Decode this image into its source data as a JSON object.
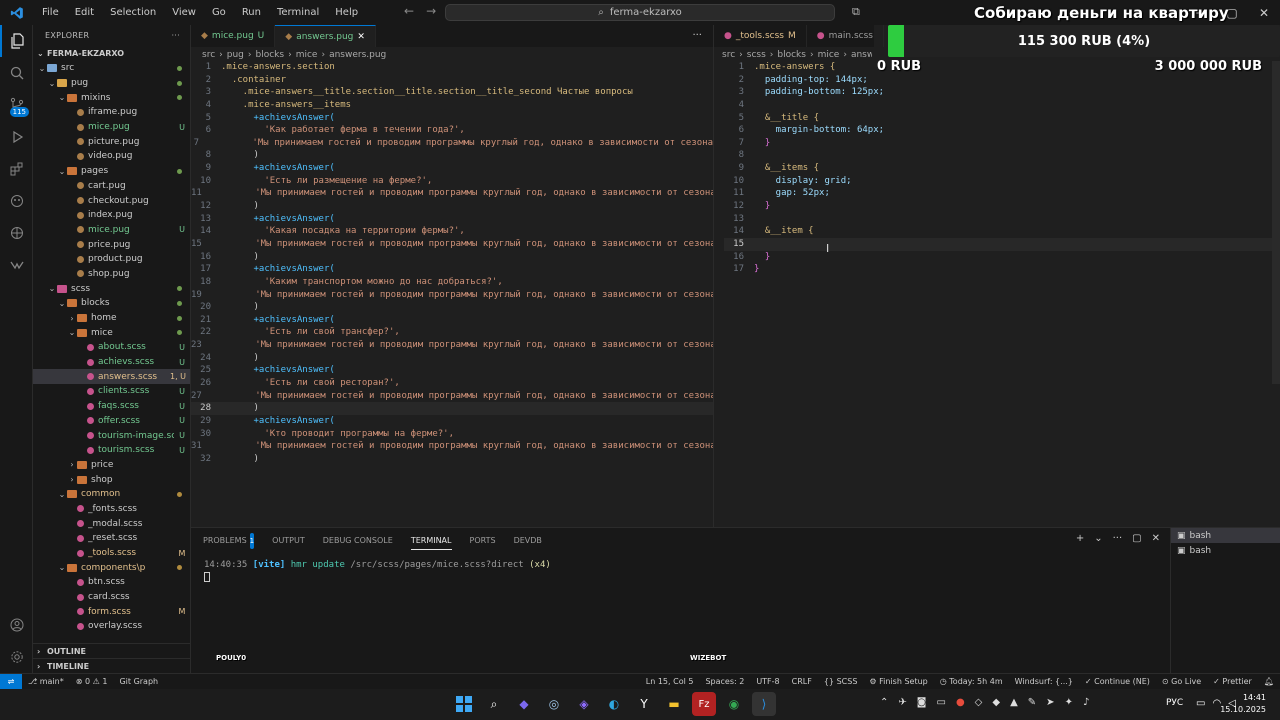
{
  "menu": [
    "File",
    "Edit",
    "Selection",
    "View",
    "Go",
    "Run",
    "Terminal",
    "Help"
  ],
  "command_center": "ferma-ekzarxo",
  "explorer": {
    "header": "EXPLORER",
    "project": "FERMA-EKZARXO",
    "rows": [
      {
        "label": "src",
        "depth": 1,
        "type": "folder",
        "open": true,
        "color": "#7ba7d4",
        "status": "",
        "dot": true
      },
      {
        "label": "pug",
        "depth": 2,
        "type": "folder",
        "open": true,
        "color": "#d9a54a",
        "status": "",
        "dot": true
      },
      {
        "label": "mixins",
        "depth": 3,
        "type": "folder",
        "open": true,
        "color": "#c9743a",
        "status": "",
        "dot": true
      },
      {
        "label": "iframe.pug",
        "depth": 4,
        "type": "file",
        "color": "#a87d4a",
        "status": ""
      },
      {
        "label": "mice.pug",
        "depth": 4,
        "type": "file",
        "color": "#a87d4a",
        "status": "U",
        "green": true
      },
      {
        "label": "picture.pug",
        "depth": 4,
        "type": "file",
        "color": "#a87d4a",
        "status": ""
      },
      {
        "label": "video.pug",
        "depth": 4,
        "type": "file",
        "color": "#a87d4a",
        "status": ""
      },
      {
        "label": "pages",
        "depth": 3,
        "type": "folder",
        "open": true,
        "color": "#c9743a",
        "status": "",
        "dot": true
      },
      {
        "label": "cart.pug",
        "depth": 4,
        "type": "file",
        "color": "#a87d4a",
        "status": ""
      },
      {
        "label": "checkout.pug",
        "depth": 4,
        "type": "file",
        "color": "#a87d4a",
        "status": ""
      },
      {
        "label": "index.pug",
        "depth": 4,
        "type": "file",
        "color": "#a87d4a",
        "status": ""
      },
      {
        "label": "mice.pug",
        "depth": 4,
        "type": "file",
        "color": "#a87d4a",
        "status": "U",
        "green": true
      },
      {
        "label": "price.pug",
        "depth": 4,
        "type": "file",
        "color": "#a87d4a",
        "status": ""
      },
      {
        "label": "product.pug",
        "depth": 4,
        "type": "file",
        "color": "#a87d4a",
        "status": ""
      },
      {
        "label": "shop.pug",
        "depth": 4,
        "type": "file",
        "color": "#a87d4a",
        "status": ""
      },
      {
        "label": "scss",
        "depth": 2,
        "type": "folder",
        "open": true,
        "color": "#c6538c",
        "status": "",
        "dot": true
      },
      {
        "label": "blocks",
        "depth": 3,
        "type": "folder",
        "open": true,
        "color": "#c9743a",
        "status": "",
        "dot": true
      },
      {
        "label": "home",
        "depth": 4,
        "type": "folder",
        "open": false,
        "color": "#c9743a",
        "status": "",
        "dot": true
      },
      {
        "label": "mice",
        "depth": 4,
        "type": "folder",
        "open": true,
        "color": "#c9743a",
        "status": "",
        "dot": true
      },
      {
        "label": "about.scss",
        "depth": 5,
        "type": "file",
        "color": "#c6538c",
        "status": "U",
        "green": true
      },
      {
        "label": "achievs.scss",
        "depth": 5,
        "type": "file",
        "color": "#c6538c",
        "status": "U",
        "green": true
      },
      {
        "label": "answers.scss",
        "depth": 5,
        "type": "file",
        "color": "#c6538c",
        "status": "1, U",
        "green": true,
        "selected": true
      },
      {
        "label": "clients.scss",
        "depth": 5,
        "type": "file",
        "color": "#c6538c",
        "status": "U",
        "green": true
      },
      {
        "label": "faqs.scss",
        "depth": 5,
        "type": "file",
        "color": "#c6538c",
        "status": "U",
        "green": true
      },
      {
        "label": "offer.scss",
        "depth": 5,
        "type": "file",
        "color": "#c6538c",
        "status": "U",
        "green": true
      },
      {
        "label": "tourism-image.scss",
        "depth": 5,
        "type": "file",
        "color": "#c6538c",
        "status": "U",
        "green": true
      },
      {
        "label": "tourism.scss",
        "depth": 5,
        "type": "file",
        "color": "#c6538c",
        "status": "U",
        "green": true
      },
      {
        "label": "price",
        "depth": 4,
        "type": "folder",
        "open": false,
        "color": "#c9743a",
        "status": ""
      },
      {
        "label": "shop",
        "depth": 4,
        "type": "folder",
        "open": false,
        "color": "#c9743a",
        "status": ""
      },
      {
        "label": "common",
        "depth": 3,
        "type": "folder",
        "open": true,
        "color": "#c9743a",
        "status": "",
        "dot": true,
        "orange": true
      },
      {
        "label": "_fonts.scss",
        "depth": 4,
        "type": "file",
        "color": "#c6538c",
        "status": ""
      },
      {
        "label": "_modal.scss",
        "depth": 4,
        "type": "file",
        "color": "#c6538c",
        "status": ""
      },
      {
        "label": "_reset.scss",
        "depth": 4,
        "type": "file",
        "color": "#c6538c",
        "status": ""
      },
      {
        "label": "_tools.scss",
        "depth": 4,
        "type": "file",
        "color": "#c6538c",
        "status": "M",
        "orange": true
      },
      {
        "label": "components\\p",
        "depth": 3,
        "type": "folder",
        "open": true,
        "color": "#c9743a",
        "status": "",
        "dot": true,
        "orange": true
      },
      {
        "label": "btn.scss",
        "depth": 4,
        "type": "file",
        "color": "#c6538c",
        "status": ""
      },
      {
        "label": "card.scss",
        "depth": 4,
        "type": "file",
        "color": "#c6538c",
        "status": ""
      },
      {
        "label": "form.scss",
        "depth": 4,
        "type": "file",
        "color": "#c6538c",
        "status": "M",
        "orange": true
      },
      {
        "label": "overlay.scss",
        "depth": 4,
        "type": "file",
        "color": "#c6538c",
        "status": ""
      }
    ],
    "outline": "OUTLINE",
    "timeline": "TIMELINE"
  },
  "editor_left": {
    "tabs": [
      {
        "label": "mice.pug",
        "status": "U",
        "active": false
      },
      {
        "label": "answers.pug",
        "status": "",
        "active": true
      }
    ],
    "breadcrumb": [
      "src",
      "pug",
      "blocks",
      "mice",
      "answers.pug"
    ],
    "lines": [
      {
        "n": 1,
        "t": ".mice-answers.section"
      },
      {
        "n": 2,
        "t": "  .container"
      },
      {
        "n": 3,
        "t": "    .mice-answers__title.section__title.section__title_second Частые вопросы"
      },
      {
        "n": 4,
        "t": "    .mice-answers__items"
      },
      {
        "n": 5,
        "t": "      +achievsAnswer("
      },
      {
        "n": 6,
        "t": "        'Как работает ферма в течении года?',"
      },
      {
        "n": 7,
        "t": "        'Мы принимаем гостей и проводим программы круглый год, однако в зависимости от сезона"
      },
      {
        "n": 8,
        "t": "      )"
      },
      {
        "n": 9,
        "t": "      +achievsAnswer("
      },
      {
        "n": 10,
        "t": "        'Есть ли размещение на ферме?',"
      },
      {
        "n": 11,
        "t": "        'Мы принимаем гостей и проводим программы круглый год, однако в зависимости от сезона"
      },
      {
        "n": 12,
        "t": "      )"
      },
      {
        "n": 13,
        "t": "      +achievsAnswer("
      },
      {
        "n": 14,
        "t": "        'Какая посадка на территории фермы?',"
      },
      {
        "n": 15,
        "t": "        'Мы принимаем гостей и проводим программы круглый год, однако в зависимости от сезона"
      },
      {
        "n": 16,
        "t": "      )"
      },
      {
        "n": 17,
        "t": "      +achievsAnswer("
      },
      {
        "n": 18,
        "t": "        'Каким транспортом можно до нас добраться?',"
      },
      {
        "n": 19,
        "t": "        'Мы принимаем гостей и проводим программы круглый год, однако в зависимости от сезона"
      },
      {
        "n": 20,
        "t": "      )"
      },
      {
        "n": 21,
        "t": "      +achievsAnswer("
      },
      {
        "n": 22,
        "t": "        'Есть ли свой трансфер?',"
      },
      {
        "n": 23,
        "t": "        'Мы принимаем гостей и проводим программы круглый год, однако в зависимости от сезона"
      },
      {
        "n": 24,
        "t": "      )"
      },
      {
        "n": 25,
        "t": "      +achievsAnswer("
      },
      {
        "n": 26,
        "t": "        'Есть ли свой ресторан?',"
      },
      {
        "n": 27,
        "t": "        'Мы принимаем гостей и проводим программы круглый год, однако в зависимости от сезона"
      },
      {
        "n": 28,
        "t": "      )"
      },
      {
        "n": 29,
        "t": "      +achievsAnswer("
      },
      {
        "n": 30,
        "t": "        'Кто проводит программы на ферме?',"
      },
      {
        "n": 31,
        "t": "        'Мы принимаем гостей и проводим программы круглый год, однако в зависимости от сезона"
      },
      {
        "n": 32,
        "t": "      )"
      }
    ],
    "current_line": 28
  },
  "editor_right": {
    "tabs": [
      {
        "label": "_tools.scss",
        "status": "M",
        "active": false
      },
      {
        "label": "main.scss",
        "status": "",
        "active": false
      }
    ],
    "breadcrumb": [
      "src",
      "scss",
      "blocks",
      "mice",
      "answe"
    ],
    "lines": [
      {
        "n": 1,
        "t": ".mice-answers {"
      },
      {
        "n": 2,
        "t": "  padding-top: 144px;"
      },
      {
        "n": 3,
        "t": "  padding-bottom: 125px;"
      },
      {
        "n": 4,
        "t": ""
      },
      {
        "n": 5,
        "t": "  &__title {"
      },
      {
        "n": 6,
        "t": "    margin-bottom: 64px;"
      },
      {
        "n": 7,
        "t": "  }"
      },
      {
        "n": 8,
        "t": ""
      },
      {
        "n": 9,
        "t": "  &__items {"
      },
      {
        "n": 10,
        "t": "    display: grid;"
      },
      {
        "n": 11,
        "t": "    gap: 52px;"
      },
      {
        "n": 12,
        "t": "  }"
      },
      {
        "n": 13,
        "t": ""
      },
      {
        "n": 14,
        "t": "  &__item {"
      },
      {
        "n": 15,
        "t": "    "
      },
      {
        "n": 16,
        "t": "  }"
      },
      {
        "n": 17,
        "t": "}"
      }
    ],
    "current_line": 15
  },
  "panel": {
    "tabs": [
      "PROBLEMS",
      "OUTPUT",
      "DEBUG CONSOLE",
      "TERMINAL",
      "PORTS",
      "DEVDB"
    ],
    "problems_count": "1",
    "active_tab": "TERMINAL",
    "terminal_time": "14:40:35",
    "terminal_tag": "[vite]",
    "terminal_msg": "hmr update",
    "terminal_path": "/src/scss/pages/mice.scss?direct",
    "terminal_count": "(x4)",
    "shells": [
      "bash",
      "bash"
    ]
  },
  "statusbar": {
    "branch": "main*",
    "errors": "0",
    "warnings": "1",
    "git_graph": "Git Graph",
    "position": "Ln 15, Col 5",
    "spaces": "Spaces: 2",
    "encoding": "UTF-8",
    "eol": "CRLF",
    "language": "SCSS",
    "finish_setup": "Finish Setup",
    "today": "Today: 5h 4m",
    "windsurf": "Windsurf: {...}",
    "continue": "Continue (NE)",
    "go_live": "Go Live",
    "prettier": "Prettier"
  },
  "donation": {
    "title": "Собираю деньги на квартиру",
    "current": "115 300 RUB (4%)",
    "progress": 0.04,
    "min": "0 RUB",
    "max": "3 000 000 RUB",
    "color": "#2ecc40"
  },
  "stream": {
    "left_label": "POULY0",
    "right_label": "WIZEBOT"
  },
  "taskbar": {
    "lang": "РУС",
    "time": "14:41",
    "date": "15.10.2025"
  },
  "colors": {
    "accent": "#0078d4",
    "untracked": "#73c991",
    "modified": "#e2c08d",
    "string": "#ce9178",
    "selector": "#d7ba7d",
    "property": "#9cdcfe",
    "number": "#b5cea8"
  }
}
